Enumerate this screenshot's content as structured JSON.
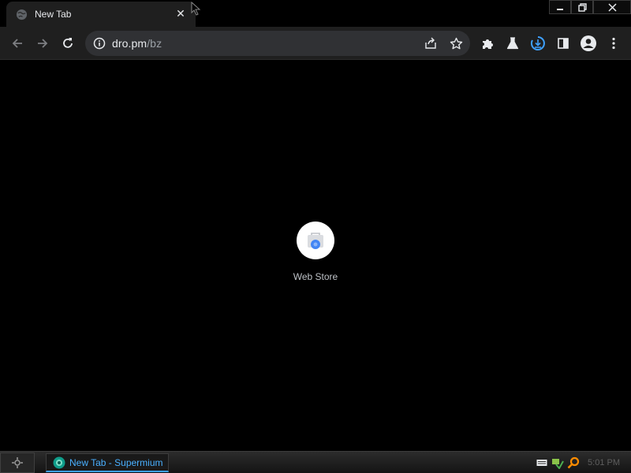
{
  "tab": {
    "title": "New Tab",
    "close_glyph": "✕"
  },
  "window_controls": {
    "minimize": "minimize-icon",
    "restore": "restore-icon",
    "close": "close-icon"
  },
  "toolbar": {
    "back": "back-arrow-icon",
    "forward": "forward-arrow-icon",
    "reload": "reload-icon",
    "url_host": "dro.pm",
    "url_path": "/bz",
    "share": "share-icon",
    "bookmark": "star-icon",
    "extensions": "puzzle-icon",
    "labs": "flask-icon",
    "download": "download-icon",
    "side_panel": "side-panel-icon",
    "profile": "profile-icon",
    "menu": "kebab-menu-icon"
  },
  "page": {
    "shortcuts": [
      {
        "label": "Web Store",
        "icon": "web-store-icon"
      }
    ]
  },
  "taskbar": {
    "task_label": "New Tab - Supermium",
    "clock": "5:01 PM"
  },
  "colors": {
    "accent": "#3ea1ff",
    "toolbar": "#1f1f1f",
    "omnibox": "#303134"
  }
}
